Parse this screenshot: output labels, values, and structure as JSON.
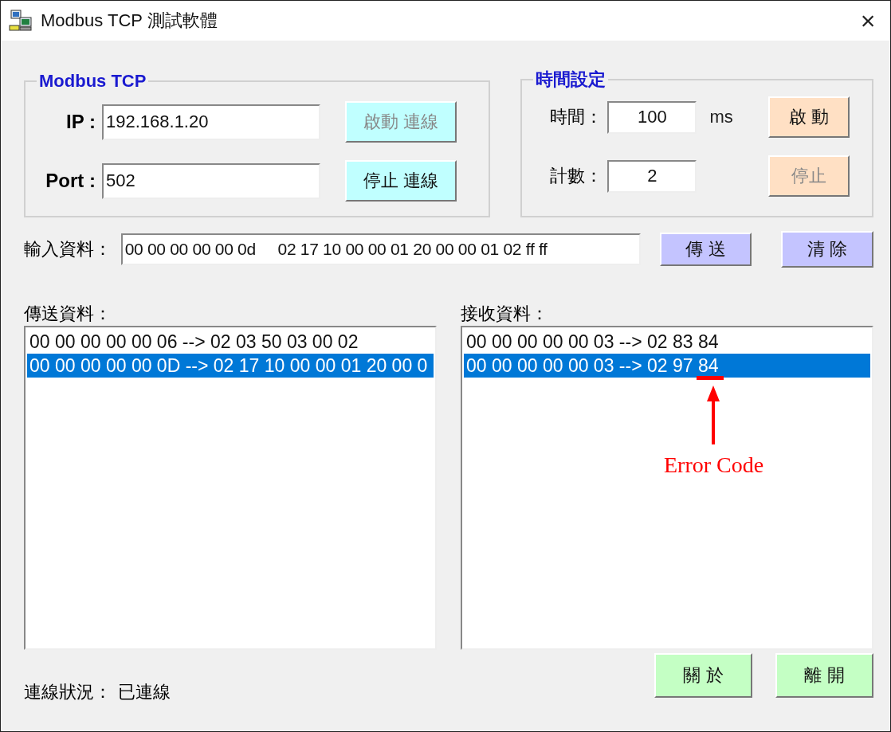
{
  "window": {
    "title": "Modbus TCP 測試軟體",
    "close": "×"
  },
  "connection": {
    "title": "Modbus TCP",
    "fields": [
      {
        "label": "IP :",
        "value": "192.168.1.20"
      },
      {
        "label": "Port :",
        "value": "502"
      }
    ],
    "buttons": [
      {
        "label": "啟動 連線",
        "disabled": true
      },
      {
        "label": "停止 連線",
        "disabled": false
      }
    ]
  },
  "timer": {
    "title": "時間設定",
    "fields": [
      {
        "label": "時間：",
        "value": "100",
        "unit": "ms"
      },
      {
        "label": "計數：",
        "value": "2"
      }
    ],
    "buttons": [
      {
        "label": "啟 動",
        "disabled": false
      },
      {
        "label": "停止",
        "disabled": true
      }
    ]
  },
  "input": {
    "label": "輸入資料：",
    "value": "00 00 00 00 00 0d     02 17 10 00 00 01 20 00 00 01 02 ff ff",
    "buttons": [
      {
        "label": "傳 送"
      },
      {
        "label": "清 除"
      }
    ]
  },
  "sent": {
    "label": "傳送資料：",
    "items": [
      {
        "text": "00 00 00 00 00 06 --> 02 03 50 03 00 02",
        "selected": false
      },
      {
        "text": "00 00 00 00 00 0D --> 02 17 10 00 00 01 20 00 0",
        "selected": true
      }
    ]
  },
  "received": {
    "label": "接收資料：",
    "items": [
      {
        "text": "00 00 00 00 00 03 --> 02 83 84",
        "selected": false
      },
      {
        "text": "00 00 00 00 00 03 --> 02 97 84",
        "selected": true
      }
    ]
  },
  "annotation": {
    "text": "Error Code"
  },
  "status": {
    "label": "連線狀況：",
    "value": "已連線"
  },
  "footer_buttons": [
    {
      "label": "關 於"
    },
    {
      "label": "離 開"
    }
  ]
}
